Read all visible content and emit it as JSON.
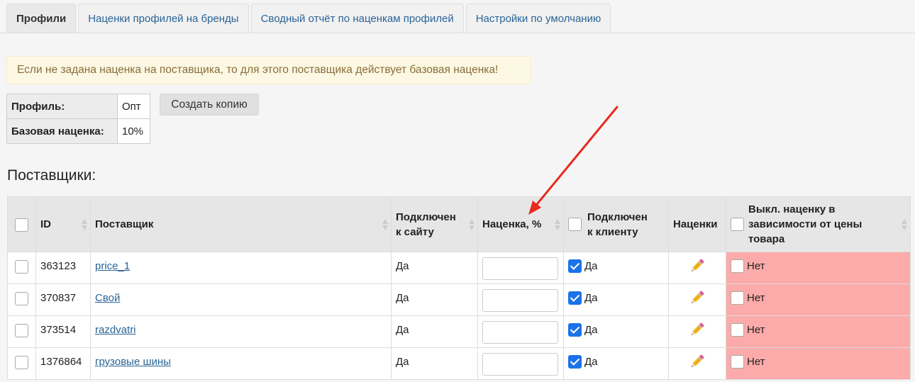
{
  "tabs": [
    {
      "label": "Профили",
      "active": true
    },
    {
      "label": "Наценки профилей на бренды",
      "active": false
    },
    {
      "label": "Сводный отчёт по наценкам профилей",
      "active": false
    },
    {
      "label": "Настройки по умолчанию",
      "active": false
    }
  ],
  "alert": "Если не задана наценка на поставщика, то для этого поставщика действует базовая наценка!",
  "profile": {
    "profile_label": "Профиль:",
    "profile_value": "Опт",
    "base_label": "Базовая наценка:",
    "base_value": "10%",
    "copy_button": "Создать копию"
  },
  "suppliers_title": "Поставщики:",
  "table": {
    "headers": {
      "id": "ID",
      "supplier": "Поставщик",
      "connected_site_1": "Подключен",
      "connected_site_2": "к сайту",
      "markup": "Наценка, %",
      "connected_client_1": "Подключен",
      "connected_client_2": "к клиенту",
      "markups": "Наценки",
      "disable_1": "Выкл. наценку в",
      "disable_2": "зависимости от цены",
      "disable_3": "товара"
    },
    "rows": [
      {
        "id": "363123",
        "supplier": "price_1",
        "site": "Да",
        "markup": "",
        "client": "Да",
        "disable": "Нет"
      },
      {
        "id": "370837",
        "supplier": "Свой",
        "site": "Да",
        "markup": "",
        "client": "Да",
        "disable": "Нет"
      },
      {
        "id": "373514",
        "supplier": "razdvatri",
        "site": "Да",
        "markup": "",
        "client": "Да",
        "disable": "Нет"
      },
      {
        "id": "1376864",
        "supplier": "грузовые шины",
        "site": "Да",
        "markup": "",
        "client": "Да",
        "disable": "Нет"
      }
    ]
  },
  "colors": {
    "link": "#2a6496",
    "alert_bg": "#fcf8e3",
    "alert_text": "#8a6d3b",
    "disabled_cell_bg": "#fdaaaa",
    "checkbox_checked": "#1a73e8",
    "annotation_arrow": "#e8291c"
  },
  "icons": {
    "markups_cell": "pencil-icon",
    "sort": "sort-arrows-icon"
  }
}
